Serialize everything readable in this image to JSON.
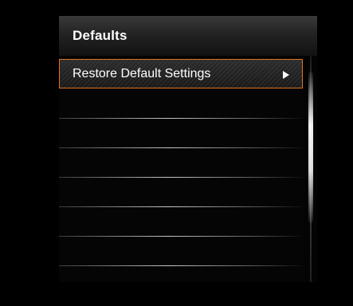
{
  "header": {
    "title": "Defaults"
  },
  "menu": {
    "items": [
      {
        "label": "Restore Default Settings",
        "icon": "arrow-right-icon",
        "selected": true
      },
      {
        "label": ""
      },
      {
        "label": ""
      },
      {
        "label": ""
      },
      {
        "label": ""
      },
      {
        "label": ""
      },
      {
        "label": ""
      }
    ]
  },
  "colors": {
    "selection_border": "#e0731f",
    "background": "#000000",
    "text": "#ffffff"
  },
  "scrollbar": {
    "position_fraction": 0.0
  }
}
